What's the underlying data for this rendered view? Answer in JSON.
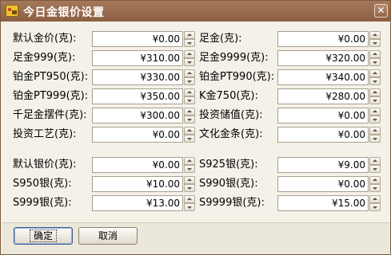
{
  "window": {
    "title": "今日金银价设置",
    "close_glyph": "✕"
  },
  "gold_fields": [
    {
      "label": "默认金价(克):",
      "value": "¥0.00"
    },
    {
      "label": "足金(克):",
      "value": "¥0.00"
    },
    {
      "label": "足金999(克):",
      "value": "¥310.00"
    },
    {
      "label": "足金9999(克):",
      "value": "¥320.00"
    },
    {
      "label": "铂金PT950(克):",
      "value": "¥330.00"
    },
    {
      "label": "铂金PT990(克):",
      "value": "¥340.00"
    },
    {
      "label": "铂金PT999(克):",
      "value": "¥350.00"
    },
    {
      "label": "K金750(克):",
      "value": "¥280.00"
    },
    {
      "label": "千足金摆件(克):",
      "value": "¥300.00"
    },
    {
      "label": "投资储值(克):",
      "value": "¥0.00"
    },
    {
      "label": "投资工艺(克):",
      "value": "¥0.00"
    },
    {
      "label": "文化金条(克):",
      "value": "¥0.00"
    }
  ],
  "silver_fields": [
    {
      "label": "默认银价(克):",
      "value": "¥0.00"
    },
    {
      "label": "S925银(克):",
      "value": "¥9.00"
    },
    {
      "label": "S950银(克):",
      "value": "¥10.00"
    },
    {
      "label": "S990银(克):",
      "value": "¥0.00"
    },
    {
      "label": "S999银(克):",
      "value": "¥13.00"
    },
    {
      "label": "S9999银(克):",
      "value": "¥15.00"
    }
  ],
  "buttons": {
    "ok_label": "确定",
    "cancel_label": "取消"
  }
}
